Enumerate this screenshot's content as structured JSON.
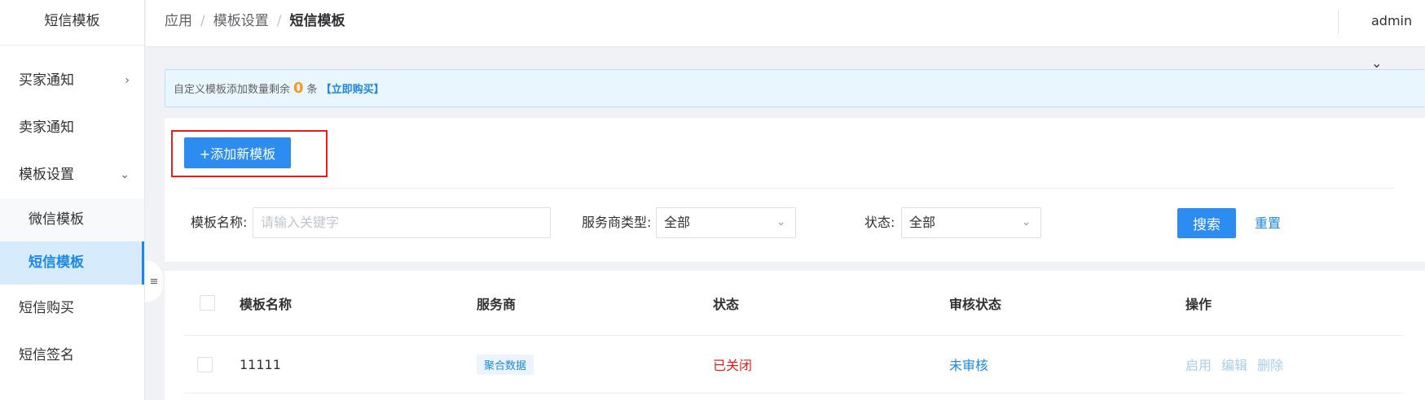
{
  "sidebar": {
    "title": "短信模板",
    "items": [
      {
        "label": "买家通知",
        "chevron": "›"
      },
      {
        "label": "卖家通知"
      },
      {
        "label": "模板设置",
        "chevron": "⌄"
      }
    ],
    "sub_items": [
      {
        "label": "微信模板"
      },
      {
        "label": "短信模板"
      }
    ],
    "bottom_items": [
      {
        "label": "短信购买"
      },
      {
        "label": "短信签名"
      }
    ],
    "collapse_icon": "≡"
  },
  "header": {
    "breadcrumb": [
      "应用",
      "模板设置",
      "短信模板"
    ],
    "separator": "/",
    "user": "admin",
    "user_chevron": "⌄"
  },
  "notice": {
    "prefix": "自定义模板添加数量剩余",
    "count": "0",
    "unit": "条",
    "buy_link": "【立即购买】"
  },
  "toolbar": {
    "add_label": "+添加新模板"
  },
  "filters": {
    "name_label": "模板名称:",
    "name_placeholder": "请输入关键字",
    "provider_label": "服务商类型:",
    "provider_value": "全部",
    "status_label": "状态:",
    "status_value": "全部",
    "dropdown_arrow": "⌄",
    "search_label": "搜索",
    "reset_label": "重置"
  },
  "table": {
    "columns": [
      "模板名称",
      "服务商",
      "状态",
      "审核状态",
      "操作"
    ],
    "rows": [
      {
        "name": "11111",
        "provider": "聚合数据",
        "status": "已关闭",
        "audit": "未审核",
        "actions": [
          "启用",
          "编辑",
          "删除"
        ]
      }
    ]
  },
  "colors": {
    "accent": "#2d8cf0",
    "link": "#1e88e5",
    "danger": "#e0201c",
    "warning": "#f59a23"
  }
}
